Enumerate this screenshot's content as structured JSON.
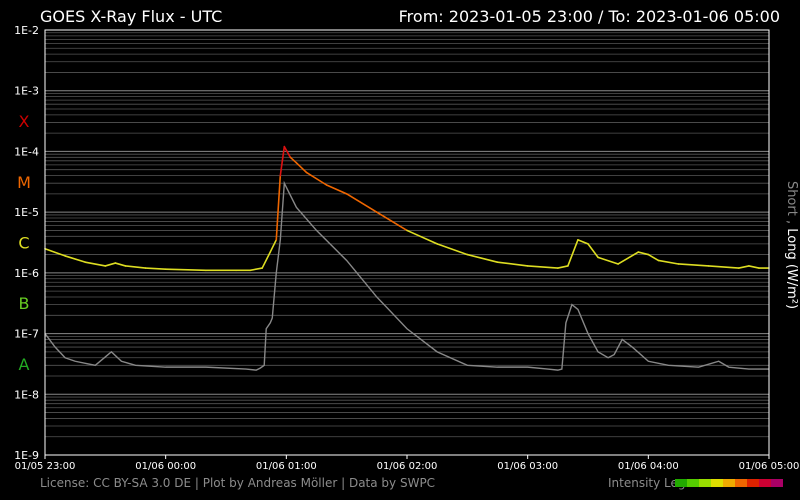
{
  "header": {
    "title": "GOES X-Ray Flux - UTC",
    "range": "From: 2023-01-05 23:00  /  To: 2023-01-06 05:00"
  },
  "footer": {
    "license": "License: CC BY-SA 3.0 DE | Plot by Andreas Möller | Data by SWPC",
    "legend_label": "Intensity Leg",
    "legend_colors": [
      "#22aa00",
      "#55cc00",
      "#99dd00",
      "#dddd00",
      "#eeaa00",
      "#ee6600",
      "#dd2200",
      "#cc0033",
      "#aa0066"
    ]
  },
  "chart_data": {
    "type": "line",
    "title": "GOES X-Ray Flux - UTC",
    "ylabel": "Short , Long (W/m²)",
    "yscale": "log",
    "ylim": [
      1e-09,
      0.01
    ],
    "xlim": [
      "2023-01-05 23:00",
      "2023-01-06 05:00"
    ],
    "grid": true,
    "y_ticks": [
      "1E-2",
      "1E-3",
      "1E-4",
      "1E-5",
      "1E-6",
      "1E-7",
      "1E-8",
      "1E-9"
    ],
    "x_ticks": [
      "01/05 23:00",
      "01/06 00:00",
      "01/06 01:00",
      "01/06 02:00",
      "01/06 03:00",
      "01/06 04:00",
      "01/06 05:00"
    ],
    "classes": [
      {
        "label": "X",
        "color": "#cc0000"
      },
      {
        "label": "M",
        "color": "#ee6600"
      },
      {
        "label": "C",
        "color": "#dddd22"
      },
      {
        "label": "B",
        "color": "#66cc22"
      },
      {
        "label": "A",
        "color": "#22aa22"
      }
    ],
    "series": [
      {
        "name": "Long",
        "color": "#dddd22",
        "x": [
          "2023-01-05 23:00",
          "2023-01-05 23:10",
          "2023-01-05 23:20",
          "2023-01-05 23:30",
          "2023-01-05 23:35",
          "2023-01-05 23:40",
          "2023-01-05 23:50",
          "2023-01-06 00:00",
          "2023-01-06 00:20",
          "2023-01-06 00:35",
          "2023-01-06 00:42",
          "2023-01-06 00:48",
          "2023-01-06 00:52",
          "2023-01-06 00:55",
          "2023-01-06 00:57",
          "2023-01-06 00:59",
          "2023-01-06 01:02",
          "2023-01-06 01:05",
          "2023-01-06 01:10",
          "2023-01-06 01:20",
          "2023-01-06 01:30",
          "2023-01-06 01:45",
          "2023-01-06 02:00",
          "2023-01-06 02:15",
          "2023-01-06 02:30",
          "2023-01-06 02:45",
          "2023-01-06 03:00",
          "2023-01-06 03:15",
          "2023-01-06 03:20",
          "2023-01-06 03:25",
          "2023-01-06 03:30",
          "2023-01-06 03:35",
          "2023-01-06 03:45",
          "2023-01-06 03:55",
          "2023-01-06 04:00",
          "2023-01-06 04:05",
          "2023-01-06 04:15",
          "2023-01-06 04:30",
          "2023-01-06 04:45",
          "2023-01-06 04:50",
          "2023-01-06 04:55",
          "2023-01-06 05:00"
        ],
        "values": [
          2.5e-06,
          1.9e-06,
          1.5e-06,
          1.3e-06,
          1.45e-06,
          1.3e-06,
          1.2e-06,
          1.15e-06,
          1.1e-06,
          1.1e-06,
          1.1e-06,
          1.2e-06,
          2.2e-06,
          3.5e-06,
          4e-05,
          0.00012,
          8e-05,
          6.5e-05,
          4.5e-05,
          2.8e-05,
          2e-05,
          1e-05,
          5e-06,
          3e-06,
          2e-06,
          1.5e-06,
          1.3e-06,
          1.2e-06,
          1.3e-06,
          3.5e-06,
          3e-06,
          1.8e-06,
          1.4e-06,
          2.2e-06,
          2e-06,
          1.6e-06,
          1.4e-06,
          1.3e-06,
          1.2e-06,
          1.3e-06,
          1.2e-06,
          1.2e-06
        ]
      },
      {
        "name": "Short",
        "color": "#888888",
        "x": [
          "2023-01-05 23:00",
          "2023-01-05 23:05",
          "2023-01-05 23:10",
          "2023-01-05 23:15",
          "2023-01-05 23:25",
          "2023-01-05 23:33",
          "2023-01-05 23:38",
          "2023-01-05 23:45",
          "2023-01-06 00:00",
          "2023-01-06 00:20",
          "2023-01-06 00:40",
          "2023-01-06 00:45",
          "2023-01-06 00:47",
          "2023-01-06 00:49",
          "2023-01-06 00:50",
          "2023-01-06 00:52",
          "2023-01-06 00:53",
          "2023-01-06 00:55",
          "2023-01-06 00:57",
          "2023-01-06 00:59",
          "2023-01-06 01:05",
          "2023-01-06 01:15",
          "2023-01-06 01:30",
          "2023-01-06 01:45",
          "2023-01-06 02:00",
          "2023-01-06 02:15",
          "2023-01-06 02:30",
          "2023-01-06 02:45",
          "2023-01-06 03:00",
          "2023-01-06 03:10",
          "2023-01-06 03:15",
          "2023-01-06 03:17",
          "2023-01-06 03:19",
          "2023-01-06 03:22",
          "2023-01-06 03:25",
          "2023-01-06 03:30",
          "2023-01-06 03:35",
          "2023-01-06 03:40",
          "2023-01-06 03:43",
          "2023-01-06 03:47",
          "2023-01-06 03:52",
          "2023-01-06 04:00",
          "2023-01-06 04:10",
          "2023-01-06 04:25",
          "2023-01-06 04:35",
          "2023-01-06 04:40",
          "2023-01-06 04:50",
          "2023-01-06 05:00"
        ],
        "values": [
          1e-07,
          6e-08,
          4e-08,
          3.5e-08,
          3e-08,
          5e-08,
          3.5e-08,
          3e-08,
          2.8e-08,
          2.8e-08,
          2.6e-08,
          2.5e-08,
          2.7e-08,
          3e-08,
          1.2e-07,
          1.5e-07,
          1.8e-07,
          1e-06,
          3.5e-06,
          3e-05,
          1.2e-05,
          5e-06,
          1.6e-06,
          4e-07,
          1.2e-07,
          5e-08,
          3e-08,
          2.8e-08,
          2.8e-08,
          2.6e-08,
          2.5e-08,
          2.6e-08,
          1.5e-07,
          3e-07,
          2.5e-07,
          1e-07,
          5e-08,
          4e-08,
          4.5e-08,
          8e-08,
          6e-08,
          3.5e-08,
          3e-08,
          2.8e-08,
          3.5e-08,
          2.8e-08,
          2.6e-08,
          2.6e-08
        ]
      }
    ]
  }
}
